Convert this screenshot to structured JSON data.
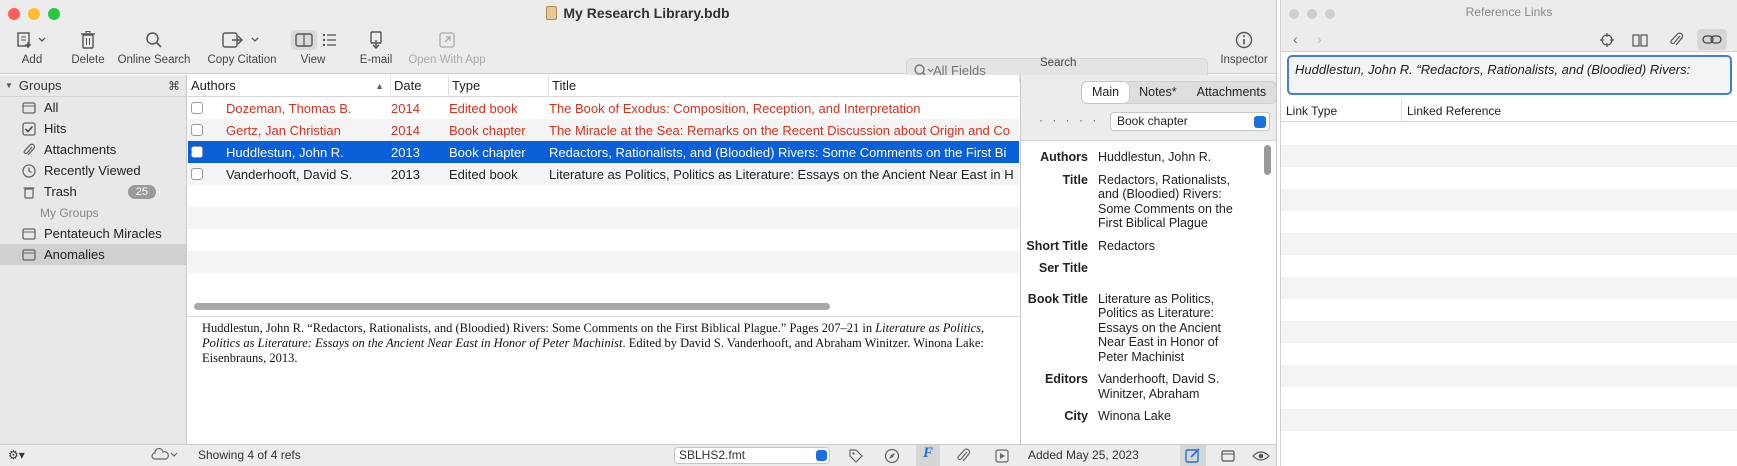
{
  "main_window": {
    "title": "My Research Library.bdb",
    "toolbar": {
      "add": "Add",
      "delete": "Delete",
      "online_search": "Online Search",
      "copy_citation": "Copy Citation",
      "view": "View",
      "email": "E-mail",
      "open_with_app": "Open With App",
      "search_label": "Search",
      "search_placeholder": "All Fields",
      "inspector": "Inspector"
    },
    "sidebar": {
      "header": "Groups",
      "header_shortcut": "⌘",
      "items": [
        {
          "label": "All",
          "icon": "folder-icon"
        },
        {
          "label": "Hits",
          "icon": "checkbox-icon"
        },
        {
          "label": "Attachments",
          "icon": "paperclip-icon"
        },
        {
          "label": "Recently Viewed",
          "icon": "clock-icon"
        },
        {
          "label": "Trash",
          "icon": "trash-icon",
          "badge": "25"
        }
      ],
      "my_groups_label": "My Groups",
      "groups": [
        {
          "label": "Pentateuch Miracles",
          "icon": "folder-icon"
        },
        {
          "label": "Anomalies",
          "icon": "folder-icon",
          "selected": true
        }
      ]
    },
    "table": {
      "columns": [
        "Authors",
        "Date",
        "Type",
        "Title"
      ],
      "rows": [
        {
          "author": "Dozeman, Thomas B.",
          "date": "2014",
          "type": "Edited book",
          "title": "The Book of Exodus: Composition, Reception, and Interpretation",
          "style": "red"
        },
        {
          "author": "Gertz, Jan Christian",
          "date": "2014",
          "type": "Book chapter",
          "title": "The Miracle at the Sea: Remarks on the Recent Discussion about Origin and Co",
          "style": "red"
        },
        {
          "author": "Huddlestun, John R.",
          "date": "2013",
          "type": "Book chapter",
          "title": "Redactors, Rationalists, and (Bloodied) Rivers: Some Comments on the First Bi",
          "style": "selected"
        },
        {
          "author": "Vanderhooft, David S.",
          "date": "2013",
          "type": "Edited book",
          "title": "Literature as Politics, Politics as Literature: Essays on the Ancient Near East in H",
          "style": "normal"
        }
      ]
    },
    "preview": {
      "part1": "Huddlestun, John R. “Redactors, Rationalists, and (Bloodied) Rivers: Some Comments on the First Biblical Plague.” Pages 207–21 in ",
      "italic": "Literature as Politics, Politics as Literature: Essays on the Ancient Near East in Honor of Peter Machinist",
      "part2": ". Edited by David S. Vanderhooft, and Abraham Winitzer. Winona Lake: Eisenbrauns, 2013."
    },
    "inspector": {
      "tabs": [
        "Main",
        "Notes*",
        "Attachments"
      ],
      "dots": "· · · · ·",
      "type": "Book chapter",
      "fields": [
        {
          "key": "Authors",
          "value": "Huddlestun, John R."
        },
        {
          "key": "Title",
          "value": "Redactors, Rationalists, and (Bloodied) Rivers: Some Comments on the First Biblical Plague"
        },
        {
          "key": "Short Title",
          "value": "Redactors"
        },
        {
          "key": "Ser Title",
          "value": ""
        },
        {
          "key": "Book Title",
          "value": "Literature as Politics, Politics as Literature: Essays on the Ancient Near East in Honor of Peter Machinist"
        },
        {
          "key": "Editors",
          "value": "Vanderhooft, David S. Winitzer, Abraham"
        },
        {
          "key": "City",
          "value": "Winona Lake"
        }
      ]
    },
    "status": {
      "count": "Showing 4 of 4 refs",
      "format": "SBLHS2.fmt",
      "added": "Added May 25, 2023"
    }
  },
  "ref_window": {
    "title": "Reference Links",
    "citation": "Huddlestun, John R. “Redactors, Rationalists, and (Bloodied) Rivers:",
    "columns": [
      "Link Type",
      "Linked Reference"
    ]
  },
  "colors": {
    "selection": "#0a60d8",
    "red_text": "#d8301c",
    "accent": "#1b6fe0"
  }
}
